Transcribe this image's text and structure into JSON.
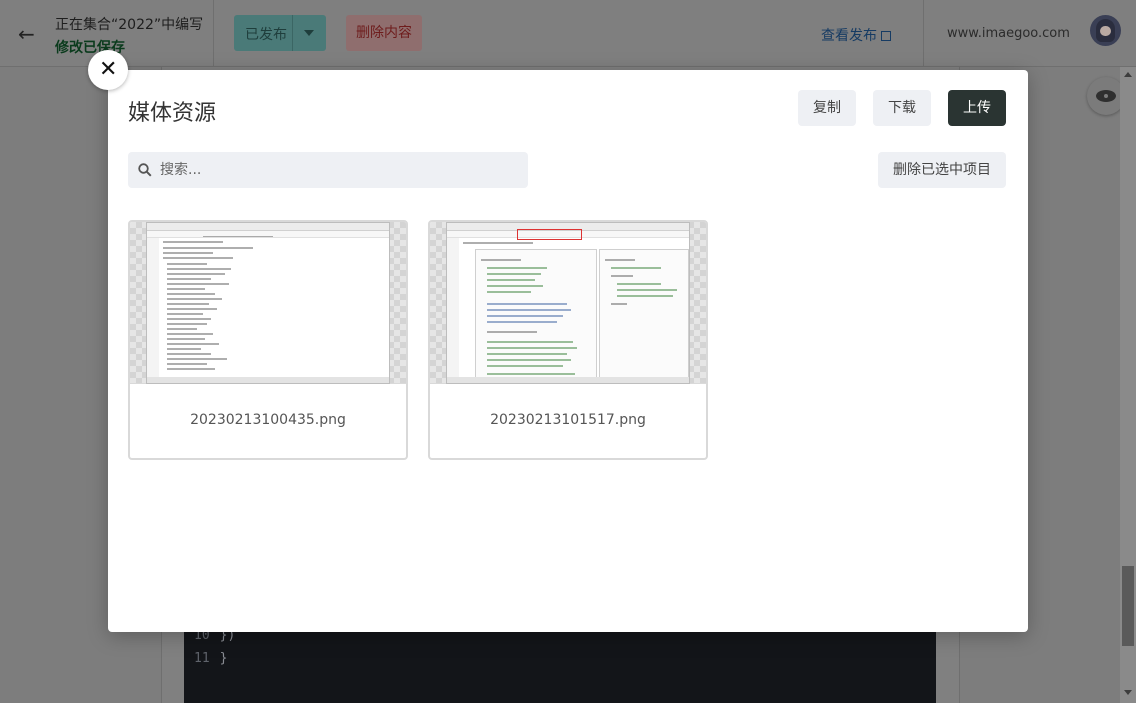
{
  "header": {
    "editing_status": "正在集合“2022”中编写",
    "save_status": "修改已保存",
    "publish_status": "已发布",
    "delete_content": "删除内容",
    "view_publish": "查看发布",
    "site_url": "www.imaegoo.com"
  },
  "background_code": {
    "line_10_number": "10",
    "line_10_text": "})",
    "line_11_number": "11",
    "line_11_text": "}"
  },
  "modal": {
    "title": "媒体资源",
    "copy_label": "复制",
    "download_label": "下载",
    "upload_label": "上传",
    "search_placeholder": "搜索...",
    "delete_selected_label": "删除已选中项目",
    "media": [
      {
        "filename": "20230213100435.png"
      },
      {
        "filename": "20230213101517.png"
      }
    ]
  },
  "icons": {
    "back": "arrow-left-icon",
    "close": "close-icon",
    "search": "search-icon",
    "external": "external-link-icon",
    "preview": "eye-icon",
    "dropdown": "chevron-down-icon"
  },
  "colors": {
    "upload_button": "#2a3432",
    "light_button": "#eef0f4",
    "modal_bg": "#ffffff",
    "overlay": "#7d7d7d"
  }
}
